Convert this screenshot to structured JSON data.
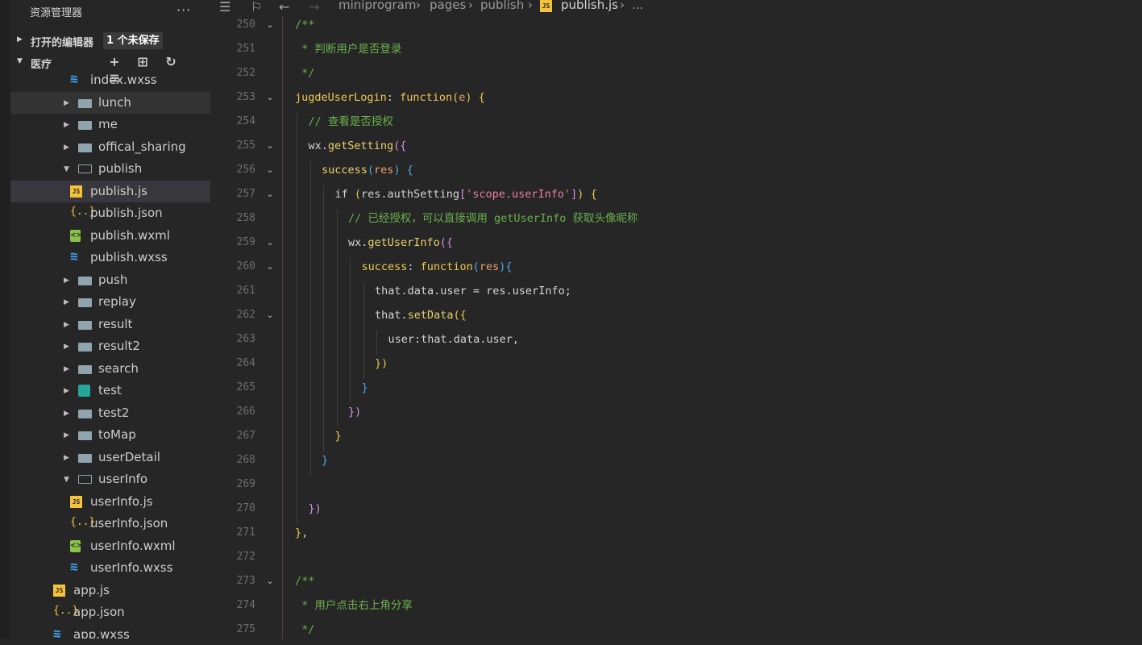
{
  "sidebar": {
    "title": "资源管理器",
    "open_editors": {
      "label": "打开的编辑器",
      "badge": "1 个未保存"
    },
    "folder": {
      "label": "医疗"
    },
    "tree": [
      {
        "name": "index.wxss",
        "type": "wxss",
        "level": 2
      },
      {
        "name": "lunch",
        "type": "folder",
        "level": 1,
        "hover": true
      },
      {
        "name": "me",
        "type": "folder",
        "level": 1
      },
      {
        "name": "offical_sharing",
        "type": "folder",
        "level": 1
      },
      {
        "name": "publish",
        "type": "folder-open",
        "level": 1
      },
      {
        "name": "publish.js",
        "type": "js",
        "level": 2,
        "selected": true
      },
      {
        "name": "publish.json",
        "type": "json",
        "level": 2
      },
      {
        "name": "publish.wxml",
        "type": "wxml",
        "level": 2
      },
      {
        "name": "publish.wxss",
        "type": "wxss",
        "level": 2
      },
      {
        "name": "push",
        "type": "folder",
        "level": 1
      },
      {
        "name": "replay",
        "type": "folder",
        "level": 1
      },
      {
        "name": "result",
        "type": "folder",
        "level": 1
      },
      {
        "name": "result2",
        "type": "folder",
        "level": 1
      },
      {
        "name": "search",
        "type": "folder",
        "level": 1
      },
      {
        "name": "test",
        "type": "test",
        "level": 1
      },
      {
        "name": "test2",
        "type": "folder",
        "level": 1
      },
      {
        "name": "toMap",
        "type": "folder",
        "level": 1
      },
      {
        "name": "userDetail",
        "type": "folder",
        "level": 1
      },
      {
        "name": "userInfo",
        "type": "folder-open",
        "level": 1
      },
      {
        "name": "userInfo.js",
        "type": "js",
        "level": 2
      },
      {
        "name": "userInfo.json",
        "type": "json",
        "level": 2
      },
      {
        "name": "userInfo.wxml",
        "type": "wxml",
        "level": 2
      },
      {
        "name": "userInfo.wxss",
        "type": "wxss",
        "level": 2
      },
      {
        "name": "app.js",
        "type": "js",
        "level": 0
      },
      {
        "name": "app.json",
        "type": "json",
        "level": 0
      },
      {
        "name": "app.wxss",
        "type": "wxss",
        "level": 0
      }
    ]
  },
  "breadcrumb": {
    "parts": [
      "miniprogram",
      "pages",
      "publish",
      "publish.js",
      "..."
    ],
    "file_badge": "JS"
  },
  "editor": {
    "line_numbers": [
      "250",
      "251",
      "252",
      "253",
      "254",
      "255",
      "256",
      "257",
      "258",
      "259",
      "260",
      "261",
      "262",
      "263",
      "264",
      "265",
      "266",
      "267",
      "268",
      "269",
      "270",
      "271",
      "272",
      "273",
      "274",
      "275"
    ],
    "foldable": [
      true,
      false,
      false,
      true,
      false,
      true,
      true,
      true,
      false,
      true,
      true,
      false,
      true,
      false,
      false,
      false,
      false,
      false,
      false,
      false,
      false,
      false,
      false,
      true,
      false,
      false
    ],
    "lines": [
      {
        "indent": 0,
        "tokens": [
          [
            "c-comment",
            "/**"
          ]
        ]
      },
      {
        "indent": 0,
        "tokens": [
          [
            "c-comment",
            " * 判断用户是否登录"
          ]
        ]
      },
      {
        "indent": 0,
        "tokens": [
          [
            "c-comment",
            " */"
          ]
        ]
      },
      {
        "indent": 0,
        "tokens": [
          [
            "c-prop",
            "jugdeUserLogin"
          ],
          [
            "c-plain",
            ": "
          ],
          [
            "c-kw",
            "function"
          ],
          [
            "c-p1",
            "("
          ],
          [
            "c-param",
            "e"
          ],
          [
            "c-p1",
            ")"
          ],
          [
            "c-plain",
            " "
          ],
          [
            "c-p1",
            "{"
          ]
        ]
      },
      {
        "indent": 1,
        "tokens": [
          [
            "c-comment",
            "// 查看是否授权"
          ]
        ]
      },
      {
        "indent": 1,
        "tokens": [
          [
            "c-plain",
            "wx."
          ],
          [
            "c-fn",
            "getSetting"
          ],
          [
            "c-p2",
            "({"
          ]
        ]
      },
      {
        "indent": 2,
        "tokens": [
          [
            "c-fn",
            "success"
          ],
          [
            "c-p3",
            "("
          ],
          [
            "c-param",
            "res"
          ],
          [
            "c-p3",
            ")"
          ],
          [
            "c-plain",
            " "
          ],
          [
            "c-p3",
            "{"
          ]
        ]
      },
      {
        "indent": 3,
        "tokens": [
          [
            "c-plain",
            "if "
          ],
          [
            "c-p1",
            "("
          ],
          [
            "c-plain",
            "res.authSetting"
          ],
          [
            "c-p2",
            "["
          ],
          [
            "c-str",
            "'scope.userInfo'"
          ],
          [
            "c-p2",
            "]"
          ],
          [
            "c-p1",
            ")"
          ],
          [
            "c-plain",
            " "
          ],
          [
            "c-p1",
            "{"
          ]
        ]
      },
      {
        "indent": 4,
        "tokens": [
          [
            "c-comment",
            "// 已经授权，可以直接调用 getUserInfo 获取头像昵称"
          ]
        ]
      },
      {
        "indent": 4,
        "tokens": [
          [
            "c-plain",
            "wx."
          ],
          [
            "c-fn",
            "getUserInfo"
          ],
          [
            "c-p2",
            "({"
          ]
        ]
      },
      {
        "indent": 5,
        "tokens": [
          [
            "c-prop",
            "success"
          ],
          [
            "c-plain",
            ": "
          ],
          [
            "c-kw",
            "function"
          ],
          [
            "c-p3",
            "("
          ],
          [
            "c-param",
            "res"
          ],
          [
            "c-p3",
            ")"
          ],
          [
            "c-p3",
            "{"
          ]
        ]
      },
      {
        "indent": 6,
        "tokens": [
          [
            "c-plain",
            "that.data.user = res.userInfo;"
          ]
        ]
      },
      {
        "indent": 6,
        "tokens": [
          [
            "c-plain",
            "that."
          ],
          [
            "c-fn",
            "setData"
          ],
          [
            "c-p1",
            "({"
          ]
        ]
      },
      {
        "indent": 7,
        "tokens": [
          [
            "c-plain",
            "user:that.data.user,"
          ]
        ]
      },
      {
        "indent": 6,
        "tokens": [
          [
            "c-p1",
            "})"
          ]
        ]
      },
      {
        "indent": 5,
        "tokens": [
          [
            "c-p3",
            "}"
          ]
        ]
      },
      {
        "indent": 4,
        "tokens": [
          [
            "c-p2",
            "})"
          ]
        ]
      },
      {
        "indent": 3,
        "tokens": [
          [
            "c-p1",
            "}"
          ]
        ]
      },
      {
        "indent": 2,
        "tokens": [
          [
            "c-p3",
            "}"
          ]
        ]
      },
      {
        "indent": 1,
        "tokens": []
      },
      {
        "indent": 1,
        "tokens": [
          [
            "c-p2",
            "})"
          ]
        ]
      },
      {
        "indent": 0,
        "tokens": [
          [
            "c-p1",
            "}"
          ],
          [
            "c-plain",
            ","
          ]
        ]
      },
      {
        "indent": 0,
        "tokens": []
      },
      {
        "indent": 0,
        "tokens": [
          [
            "c-comment",
            "/**"
          ]
        ]
      },
      {
        "indent": 0,
        "tokens": [
          [
            "c-comment",
            " * 用户点击右上角分享"
          ]
        ]
      },
      {
        "indent": 0,
        "tokens": [
          [
            "c-comment",
            " */"
          ]
        ]
      }
    ]
  }
}
